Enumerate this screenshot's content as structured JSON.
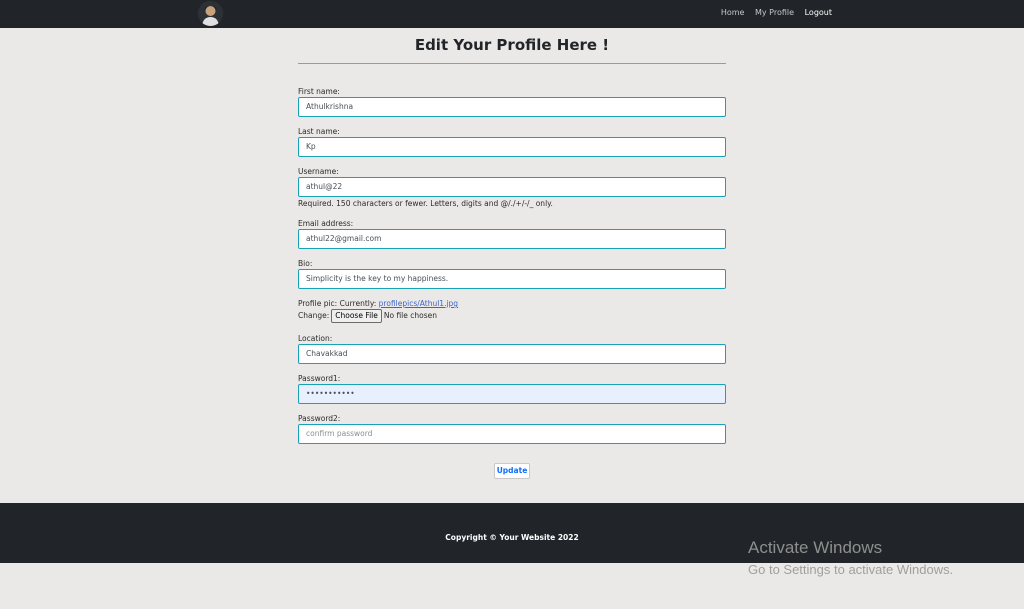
{
  "nav": {
    "links": [
      "Home",
      "My Profile",
      "Logout"
    ]
  },
  "page": {
    "title": "Edit Your Profile Here !"
  },
  "form": {
    "first_name": {
      "label": "First name:",
      "value": "Athulkrishna"
    },
    "last_name": {
      "label": "Last name:",
      "value": "Kp"
    },
    "username": {
      "label": "Username:",
      "value": "athul@22",
      "help": "Required. 150 characters or fewer. Letters, digits and @/./+/-/_ only."
    },
    "email": {
      "label": "Email address:",
      "value": "athul22@gmail.com"
    },
    "bio": {
      "label": "Bio:",
      "value": "Simplicity is the key to my happiness."
    },
    "profile_pic": {
      "label": "Profile pic:",
      "currently_label": "Currently:",
      "current_file": "profilepics/Athul1.jpg",
      "change_label": "Change:",
      "choose_button": "Choose File",
      "no_file": "No file chosen"
    },
    "location": {
      "label": "Location:",
      "value": "Chavakkad"
    },
    "password1": {
      "label": "Password1:",
      "value": "•••••••••••"
    },
    "password2": {
      "label": "Password2:",
      "placeholder": "confirm password"
    },
    "submit_label": "Update"
  },
  "footer": {
    "text": "Copyright © Your Website 2022"
  },
  "windows_watermark": {
    "title": "Activate Windows",
    "subtitle": "Go to Settings to activate Windows."
  }
}
